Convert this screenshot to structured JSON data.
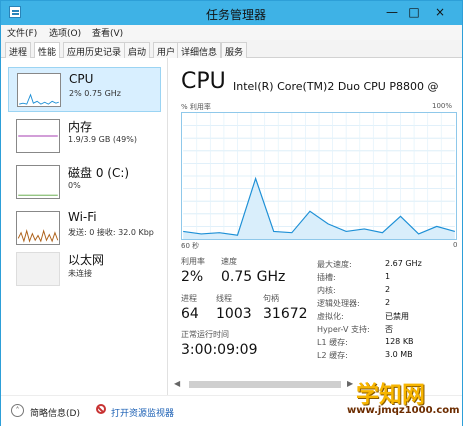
{
  "window": {
    "title": "任务管理器",
    "minimize": "—",
    "maximize": "□",
    "close": "×"
  },
  "menu": [
    "文件(F)",
    "选项(O)",
    "查看(V)"
  ],
  "tabs": [
    "进程",
    "性能",
    "应用历史记录",
    "启动",
    "用户",
    "详细信息",
    "服务"
  ],
  "resources": [
    {
      "name": "CPU",
      "sub": "2% 0.75 GHz",
      "color": "#1e90d6"
    },
    {
      "name": "内存",
      "sub": "1.9/3.9 GB (49%)",
      "color": "#a43cb0"
    },
    {
      "name": "磁盘 0 (C:)",
      "sub": "0%",
      "color": "#58a33a"
    },
    {
      "name": "Wi-Fi",
      "sub": "发送: 0 接收: 32.0 Kbp",
      "color": "#ad6018"
    },
    {
      "name": "以太网",
      "sub": "未连接",
      "color": "#999999"
    }
  ],
  "cpu": {
    "title": "CPU",
    "model": "Intel(R) Core(TM)2 Duo CPU P8800 @",
    "utilization_axis": "% 利用率",
    "max_percent": "100%",
    "time_left": "60 秒",
    "time_right": "0",
    "utilization_label": "利用率",
    "utilization": "2%",
    "speed_label": "速度",
    "speed": "0.75 GHz",
    "processes_label": "进程",
    "processes": "64",
    "threads_label": "线程",
    "threads": "1003",
    "handles_label": "句柄",
    "handles": "31672",
    "uptime_label": "正常运行时间",
    "uptime": "3:00:09:09",
    "details": [
      {
        "label": "最大速度:",
        "value": "2.67 GHz"
      },
      {
        "label": "插槽:",
        "value": "1"
      },
      {
        "label": "内核:",
        "value": "2"
      },
      {
        "label": "逻辑处理器:",
        "value": "2"
      },
      {
        "label": "虚拟化:",
        "value": "已禁用"
      },
      {
        "label": "Hyper-V 支持:",
        "value": "否"
      },
      {
        "label": "L1 缓存:",
        "value": "128 KB"
      },
      {
        "label": "L2 缓存:",
        "value": "3.0 MB"
      }
    ]
  },
  "bottom": {
    "brief": "简略信息(D)",
    "monitor": "打开资源监视器"
  },
  "watermark": {
    "brand": "学知网",
    "url": "www.jmqz1000.com"
  },
  "chart_data": {
    "type": "line",
    "x": [
      0,
      4,
      8,
      12,
      16,
      20,
      24,
      28,
      32,
      36,
      40,
      44,
      48,
      52,
      56,
      60
    ],
    "values": [
      6,
      4,
      5,
      3,
      48,
      6,
      5,
      22,
      12,
      6,
      8,
      5,
      18,
      4,
      10,
      6
    ],
    "ylim": [
      0,
      100
    ]
  }
}
